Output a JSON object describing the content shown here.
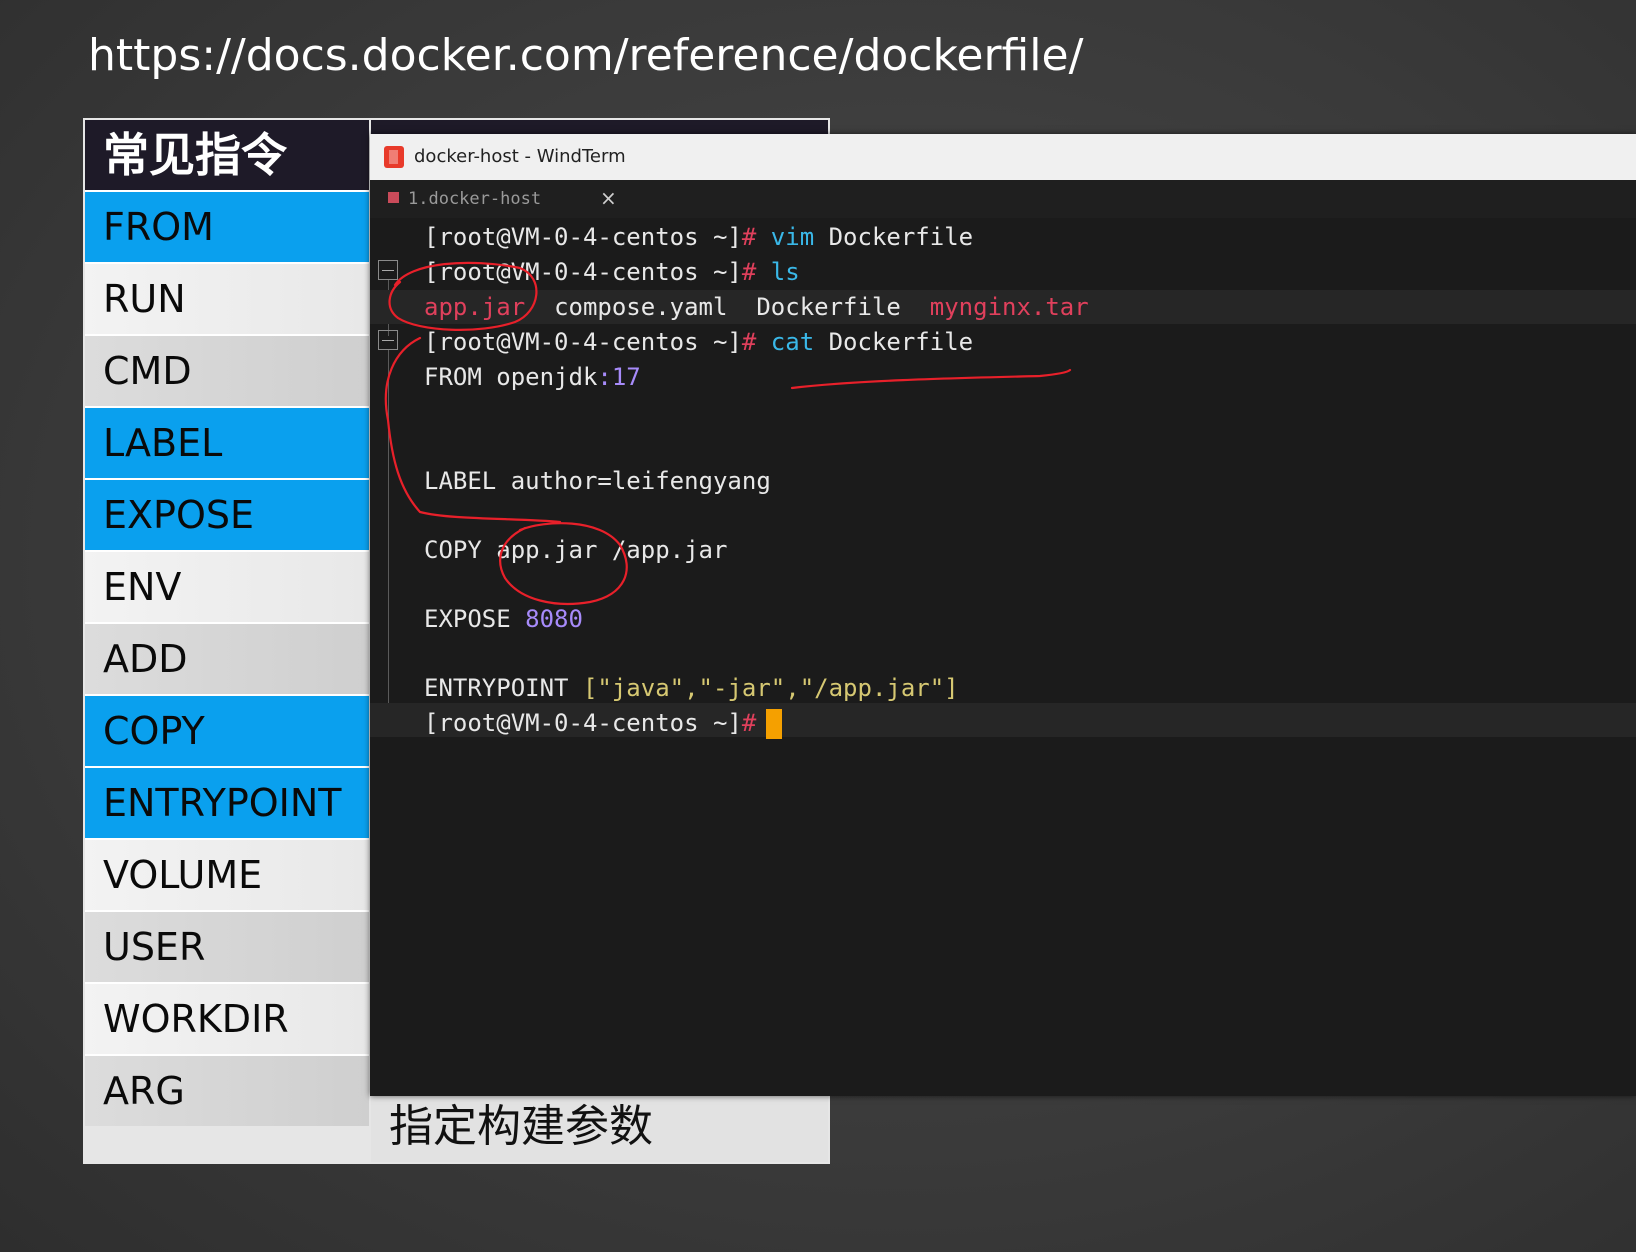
{
  "url": "https://docs.docker.com/reference/dockerfile/",
  "table": {
    "header": "常见指令",
    "rows": [
      {
        "label": "FROM",
        "style": "blue"
      },
      {
        "label": "RUN",
        "style": "light"
      },
      {
        "label": "CMD",
        "style": "gray"
      },
      {
        "label": "LABEL",
        "style": "blue"
      },
      {
        "label": "EXPOSE",
        "style": "blue"
      },
      {
        "label": "ENV",
        "style": "light"
      },
      {
        "label": "ADD",
        "style": "gray"
      },
      {
        "label": "COPY",
        "style": "blue"
      },
      {
        "label": "ENTRYPOINT",
        "style": "blue"
      },
      {
        "label": "VOLUME",
        "style": "light"
      },
      {
        "label": "USER",
        "style": "gray"
      },
      {
        "label": "WORKDIR",
        "style": "light"
      },
      {
        "label": "ARG",
        "style": "gray"
      }
    ],
    "arg_description": "指定构建参数"
  },
  "window": {
    "title": "docker-host - WindTerm",
    "tab_label": "1.docker-host",
    "tab_close": "×"
  },
  "terminal": {
    "prompt": "[root@VM-0-4-centos ~]",
    "hash": "#",
    "line1_cmd": "vim",
    "line1_arg": "Dockerfile",
    "line2_cmd": "ls",
    "ls_files": [
      "app.jar",
      "compose.yaml",
      "Dockerfile",
      "mynginx.tar"
    ],
    "line4_cmd": "cat",
    "line4_arg": "Dockerfile",
    "from_kw": "FROM",
    "from_image": "openjdk",
    "from_colon": ":",
    "from_tag": "17",
    "label_line": "LABEL author=leifengyang",
    "copy_line": "COPY app.jar /app.jar",
    "expose_kw": "EXPOSE",
    "expose_port": "8080",
    "entry_kw": "ENTRYPOINT",
    "entry_args": "[\"java\",\"-jar\",\"/app.jar\"]"
  },
  "colors": {
    "blue_row": "#0aa0ee",
    "prompt_hash": "#e0405c",
    "command": "#3ab8e8",
    "number": "#a78bfa",
    "annotation": "#e8202a",
    "cursor": "#f5a000"
  }
}
